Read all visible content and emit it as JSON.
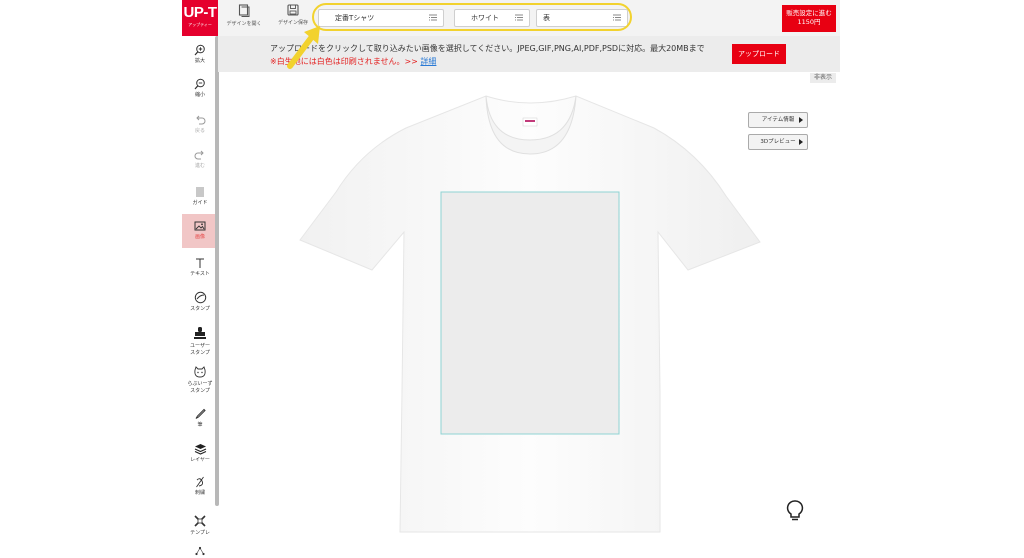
{
  "logo": {
    "main": "UP-T",
    "sub": "アップティー"
  },
  "toolbar": {
    "open_design": "デザインを開く",
    "save_design": "デザイン保存",
    "item_select": "定番Tシャツ",
    "color_select": "ホワイト",
    "side_select": "表",
    "sale_button_line1": "販売設定に進む",
    "sale_button_line2": "1150円"
  },
  "banner": {
    "message": "アップロードをクリックして取り込みたい画像を選択してください。JPEG,GIF,PNG,AI,PDF,PSDに対応。最大20MBまで",
    "warning": "※白生地には白色は印刷されません。>>",
    "detail_link": "詳細",
    "upload_button": "アップロード",
    "hide_label": "非表示"
  },
  "side_buttons": {
    "item_info": "アイテム情報",
    "preview_3d": "3Dプレビュー"
  },
  "sidebar": {
    "items": [
      {
        "label": "拡大",
        "icon": "zoom-in-icon"
      },
      {
        "label": "縮小",
        "icon": "zoom-out-icon"
      },
      {
        "label": "戻る",
        "icon": "undo-icon"
      },
      {
        "label": "進む",
        "icon": "redo-icon"
      },
      {
        "label": "ガイド",
        "icon": "guide-icon"
      },
      {
        "label": "画像",
        "icon": "image-icon"
      },
      {
        "label": "テキスト",
        "icon": "text-icon"
      },
      {
        "label": "スタンプ",
        "icon": "stamp-icon"
      },
      {
        "label": "ユーザー",
        "label2": "スタンプ",
        "icon": "user-stamp-icon"
      },
      {
        "label": "らぶいーず",
        "label2": "スタンプ",
        "icon": "cat-stamp-icon"
      },
      {
        "label": "筆",
        "icon": "brush-icon"
      },
      {
        "label": "レイヤー",
        "icon": "layer-icon"
      },
      {
        "label": "刺繍",
        "icon": "embroidery-icon"
      },
      {
        "label": "テンプレ",
        "icon": "template-icon"
      }
    ]
  },
  "colors": {
    "accent": "#e80012",
    "highlight": "#f2d22e",
    "print_area": "#8fd3d3"
  }
}
